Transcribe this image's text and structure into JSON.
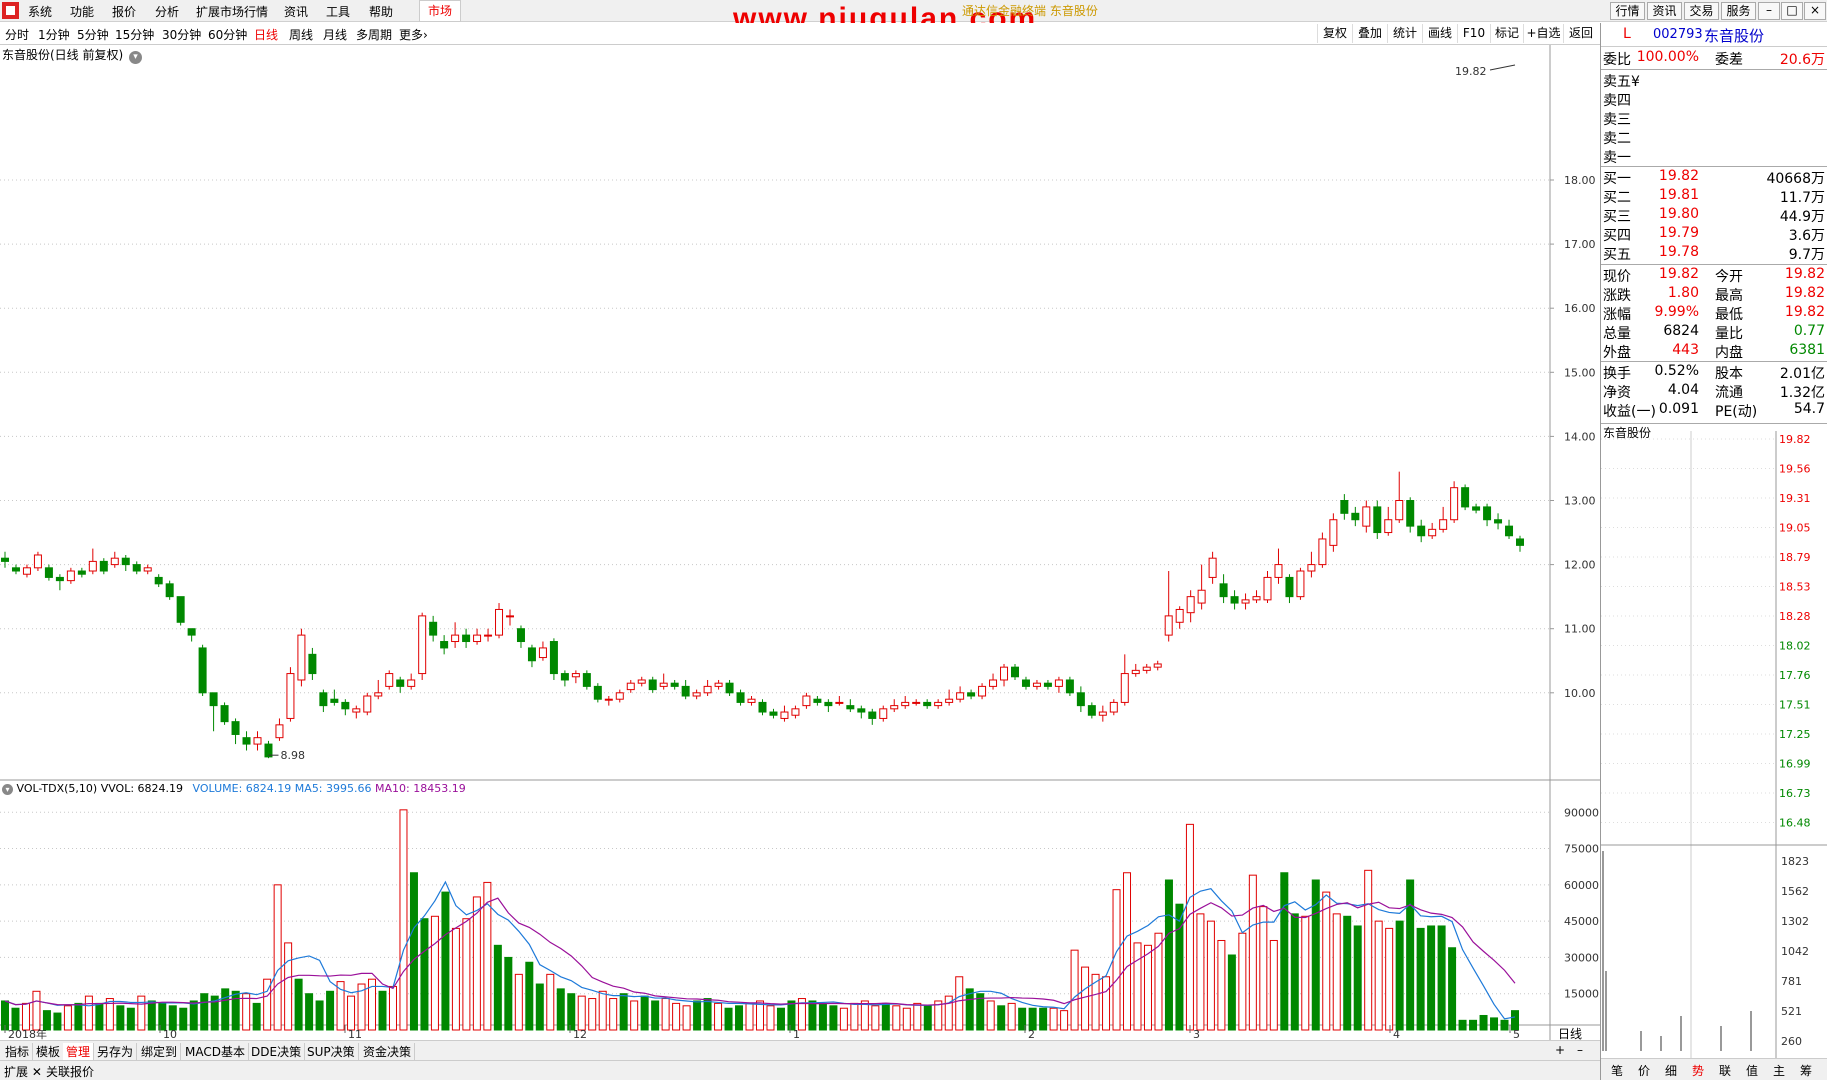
{
  "menu": {
    "items": [
      "系统",
      "功能",
      "报价",
      "分析",
      "扩展市场行情",
      "资讯",
      "工具",
      "帮助"
    ],
    "market_tab": "市场"
  },
  "watermark": "www.niugulan.com",
  "window_subtitle": "通达信金融终端 东音股份",
  "right_top_buttons": [
    "行情",
    "资讯",
    "交易",
    "服务"
  ],
  "period_bar": {
    "periods": [
      "分时",
      "1分钟",
      "5分钟",
      "15分钟",
      "30分钟",
      "60分钟",
      "日线",
      "周线",
      "月线",
      "多周期",
      "更多"
    ],
    "active": "日线",
    "tools": [
      "复权",
      "叠加",
      "统计",
      "画线",
      "F10",
      "标记",
      "+自选",
      "返回"
    ]
  },
  "chart_title": "东音股份(日线 前复权)",
  "right_axis": {
    "ticks": [
      "18.00",
      "17.00",
      "16.00",
      "15.00",
      "14.00",
      "13.00",
      "12.00",
      "11.00",
      "10.00"
    ],
    "vol_ticks": [
      "90000",
      "75000",
      "60000",
      "45000",
      "30000",
      "15000"
    ],
    "period_label": "日线"
  },
  "annotations": {
    "high": "19.82",
    "low": "8.98"
  },
  "volume_info": {
    "title": "VOL-TDX(5,10)",
    "vvol": "VVOL: 6824.19",
    "volume": "VOLUME: 6824.19",
    "ma5": "MA5: 3995.66",
    "ma10": "MA10: 18453.19"
  },
  "x_axis_labels": [
    "2018年",
    "10",
    "11",
    "12",
    "1",
    "2",
    "3",
    "4",
    "5"
  ],
  "bottom_tabs": [
    "指标",
    "模板",
    "管理",
    "另存为",
    "绑定到",
    "MACD基本",
    "DDE决策",
    "SUP决策",
    "资金决策"
  ],
  "bottom_tabs_active": "管理",
  "bottom_bar2": [
    "扩展",
    "关联报价"
  ],
  "quote": {
    "status": "L",
    "code": "002793",
    "name": "东音股份",
    "weibi_label": "委比",
    "weibi": "100.00%",
    "weicha_label": "委差",
    "weicha": "20.6万",
    "sells": [
      {
        "label": "卖五",
        "price": "",
        "vol": "",
        "mark": "¥"
      },
      {
        "label": "卖四",
        "price": "",
        "vol": ""
      },
      {
        "label": "卖三",
        "price": "",
        "vol": ""
      },
      {
        "label": "卖二",
        "price": "",
        "vol": ""
      },
      {
        "label": "卖一",
        "price": "",
        "vol": ""
      }
    ],
    "buys": [
      {
        "label": "买一",
        "price": "19.82",
        "vol": "40668万"
      },
      {
        "label": "买二",
        "price": "19.81",
        "vol": "11.7万"
      },
      {
        "label": "买三",
        "price": "19.80",
        "vol": "44.9万"
      },
      {
        "label": "买四",
        "price": "19.79",
        "vol": "3.6万"
      },
      {
        "label": "买五",
        "price": "19.78",
        "vol": "9.7万"
      }
    ],
    "stats": [
      {
        "l1": "现价",
        "v1": "19.82",
        "l2": "今开",
        "v2": "19.82",
        "c1": "red",
        "c2": "red"
      },
      {
        "l1": "涨跌",
        "v1": "1.80",
        "l2": "最高",
        "v2": "19.82",
        "c1": "red",
        "c2": "red"
      },
      {
        "l1": "涨幅",
        "v1": "9.99%",
        "l2": "最低",
        "v2": "19.82",
        "c1": "red",
        "c2": "red"
      },
      {
        "l1": "总量",
        "v1": "6824",
        "l2": "量比",
        "v2": "0.77",
        "c1": "",
        "c2": "green"
      },
      {
        "l1": "外盘",
        "v1": "443",
        "l2": "内盘",
        "v2": "6381",
        "c1": "red",
        "c2": "green"
      }
    ],
    "fin": [
      {
        "l1": "换手",
        "v1": "0.52%",
        "l2": "股本",
        "v2": "2.01亿"
      },
      {
        "l1": "净资",
        "v1": "4.04",
        "l2": "流通",
        "v2": "1.32亿"
      },
      {
        "l1": "收益(一)",
        "v1": "0.091",
        "l2": "PE(动)",
        "v2": "54.7"
      }
    ]
  },
  "mini_chart": {
    "name": "东音股份",
    "price_ticks": [
      "19.82",
      "19.56",
      "19.31",
      "19.05",
      "18.79",
      "18.53",
      "18.28",
      "18.02",
      "17.76",
      "17.51",
      "17.25",
      "16.99",
      "16.73",
      "16.48"
    ],
    "vol_ticks": [
      "1823",
      "1562",
      "1302",
      "1042",
      "781",
      "521",
      "260"
    ]
  },
  "right_tabs": [
    "笔",
    "价",
    "细",
    "势",
    "联",
    "值",
    "主",
    "筹"
  ],
  "right_tabs_active": "势",
  "colors": {
    "up": "#e00000",
    "down": "#008800",
    "ma5": "#1e7ad9",
    "ma10": "#9a109a"
  },
  "chart_data": {
    "type": "candlestick",
    "title": "东音股份(日线 前复权)",
    "ylim": [
      9.5,
      18.0
    ],
    "note_values": "approximate daily OHLC read off the chart",
    "candles": [
      [
        12.1,
        12.05,
        12.2,
        11.95
      ],
      [
        11.95,
        11.9,
        12.0,
        11.85
      ],
      [
        11.85,
        11.95,
        12.0,
        11.8
      ],
      [
        11.95,
        12.15,
        12.2,
        11.9
      ],
      [
        11.95,
        11.8,
        12.0,
        11.75
      ],
      [
        11.8,
        11.75,
        11.85,
        11.6
      ],
      [
        11.75,
        11.9,
        11.95,
        11.7
      ],
      [
        11.9,
        11.85,
        11.95,
        11.8
      ],
      [
        11.9,
        12.05,
        12.25,
        11.85
      ],
      [
        12.05,
        11.9,
        12.1,
        11.85
      ],
      [
        12.0,
        12.1,
        12.2,
        11.95
      ],
      [
        12.1,
        12.0,
        12.15,
        11.9
      ],
      [
        12.0,
        11.9,
        12.05,
        11.85
      ],
      [
        11.9,
        11.95,
        12.0,
        11.85
      ],
      [
        11.8,
        11.7,
        11.85,
        11.65
      ],
      [
        11.7,
        11.5,
        11.75,
        11.45
      ],
      [
        11.5,
        11.1,
        11.5,
        11.05
      ],
      [
        11.0,
        10.9,
        11.0,
        10.8
      ],
      [
        10.7,
        10.0,
        10.75,
        9.95
      ],
      [
        10.0,
        9.8,
        10.0,
        9.4
      ],
      [
        9.8,
        9.55,
        9.85,
        9.5
      ],
      [
        9.55,
        9.35,
        9.6,
        9.2
      ],
      [
        9.3,
        9.2,
        9.4,
        9.1
      ],
      [
        9.2,
        9.3,
        9.4,
        9.1
      ],
      [
        9.2,
        9.0,
        9.25,
        8.98
      ],
      [
        9.3,
        9.5,
        9.6,
        9.25
      ],
      [
        9.6,
        10.3,
        10.4,
        9.55
      ],
      [
        10.2,
        10.9,
        11.0,
        10.1
      ],
      [
        10.6,
        10.3,
        10.7,
        10.2
      ],
      [
        10.0,
        9.8,
        10.05,
        9.7
      ],
      [
        9.9,
        9.85,
        10.05,
        9.8
      ],
      [
        9.85,
        9.75,
        9.9,
        9.65
      ],
      [
        9.7,
        9.75,
        9.8,
        9.6
      ],
      [
        9.7,
        9.95,
        10.0,
        9.65
      ],
      [
        9.95,
        10.0,
        10.2,
        9.9
      ],
      [
        10.1,
        10.3,
        10.35,
        10.05
      ],
      [
        10.2,
        10.1,
        10.25,
        10.0
      ],
      [
        10.1,
        10.2,
        10.3,
        10.05
      ],
      [
        10.3,
        11.2,
        11.25,
        10.2
      ],
      [
        11.1,
        10.9,
        11.2,
        10.8
      ],
      [
        10.8,
        10.7,
        10.9,
        10.6
      ],
      [
        10.8,
        10.9,
        11.1,
        10.7
      ],
      [
        10.9,
        10.8,
        11.0,
        10.7
      ],
      [
        10.8,
        10.9,
        11.0,
        10.75
      ],
      [
        10.9,
        10.9,
        11.0,
        10.8
      ],
      [
        10.9,
        11.3,
        11.4,
        10.85
      ],
      [
        11.2,
        11.2,
        11.3,
        11.05
      ],
      [
        11.0,
        10.8,
        11.05,
        10.7
      ],
      [
        10.7,
        10.5,
        10.75,
        10.4
      ],
      [
        10.55,
        10.7,
        10.8,
        10.5
      ],
      [
        10.8,
        10.3,
        10.85,
        10.2
      ],
      [
        10.3,
        10.2,
        10.35,
        10.1
      ],
      [
        10.25,
        10.3,
        10.35,
        10.15
      ],
      [
        10.3,
        10.1,
        10.35,
        10.05
      ],
      [
        10.1,
        9.9,
        10.15,
        9.85
      ],
      [
        9.9,
        9.9,
        9.95,
        9.8
      ],
      [
        9.9,
        10.0,
        10.05,
        9.85
      ],
      [
        10.05,
        10.15,
        10.2,
        10.0
      ],
      [
        10.15,
        10.2,
        10.25,
        10.1
      ],
      [
        10.2,
        10.05,
        10.25,
        10.0
      ],
      [
        10.1,
        10.15,
        10.3,
        10.05
      ],
      [
        10.15,
        10.1,
        10.2,
        10.05
      ],
      [
        10.1,
        9.95,
        10.2,
        9.9
      ],
      [
        9.95,
        10.0,
        10.05,
        9.9
      ],
      [
        10.0,
        10.1,
        10.2,
        9.95
      ],
      [
        10.1,
        10.15,
        10.2,
        10.05
      ],
      [
        10.15,
        10.0,
        10.2,
        9.95
      ],
      [
        10.0,
        9.85,
        10.05,
        9.8
      ],
      [
        9.85,
        9.9,
        9.95,
        9.8
      ],
      [
        9.85,
        9.7,
        9.9,
        9.65
      ],
      [
        9.7,
        9.65,
        9.75,
        9.6
      ],
      [
        9.6,
        9.7,
        9.8,
        9.55
      ],
      [
        9.65,
        9.75,
        9.8,
        9.6
      ],
      [
        9.8,
        9.95,
        10.0,
        9.75
      ],
      [
        9.9,
        9.85,
        9.95,
        9.8
      ],
      [
        9.85,
        9.8,
        9.9,
        9.7
      ],
      [
        9.85,
        9.85,
        9.95,
        9.8
      ],
      [
        9.8,
        9.75,
        9.9,
        9.7
      ],
      [
        9.75,
        9.7,
        9.8,
        9.6
      ],
      [
        9.7,
        9.6,
        9.75,
        9.5
      ],
      [
        9.6,
        9.75,
        9.8,
        9.55
      ],
      [
        9.75,
        9.8,
        9.9,
        9.7
      ],
      [
        9.8,
        9.85,
        9.95,
        9.75
      ],
      [
        9.85,
        9.85,
        9.9,
        9.8
      ],
      [
        9.85,
        9.8,
        9.9,
        9.75
      ],
      [
        9.8,
        9.85,
        9.9,
        9.75
      ],
      [
        9.85,
        9.9,
        10.05,
        9.8
      ],
      [
        9.9,
        10.0,
        10.1,
        9.85
      ],
      [
        10.0,
        9.95,
        10.05,
        9.9
      ],
      [
        9.95,
        10.1,
        10.15,
        9.9
      ],
      [
        10.1,
        10.2,
        10.3,
        10.05
      ],
      [
        10.2,
        10.4,
        10.45,
        10.1
      ],
      [
        10.4,
        10.25,
        10.45,
        10.2
      ],
      [
        10.2,
        10.1,
        10.25,
        10.05
      ],
      [
        10.1,
        10.15,
        10.2,
        10.05
      ],
      [
        10.15,
        10.1,
        10.2,
        10.05
      ],
      [
        10.1,
        10.2,
        10.25,
        10.0
      ],
      [
        10.2,
        10.0,
        10.25,
        9.95
      ],
      [
        10.0,
        9.8,
        10.1,
        9.7
      ],
      [
        9.8,
        9.65,
        9.85,
        9.6
      ],
      [
        9.65,
        9.7,
        9.8,
        9.55
      ],
      [
        9.7,
        9.85,
        9.9,
        9.65
      ],
      [
        9.85,
        10.3,
        10.6,
        9.8
      ],
      [
        10.3,
        10.35,
        10.45,
        10.25
      ],
      [
        10.35,
        10.4,
        10.45,
        10.3
      ],
      [
        10.4,
        10.45,
        10.5,
        10.35
      ],
      [
        10.9,
        11.2,
        11.9,
        10.8
      ],
      [
        11.1,
        11.3,
        11.35,
        11.0
      ],
      [
        11.25,
        11.5,
        11.6,
        11.1
      ],
      [
        11.4,
        11.6,
        12.0,
        11.3
      ],
      [
        11.8,
        12.1,
        12.2,
        11.7
      ],
      [
        11.7,
        11.5,
        11.85,
        11.4
      ],
      [
        11.5,
        11.4,
        11.6,
        11.3
      ],
      [
        11.4,
        11.45,
        11.55,
        11.3
      ],
      [
        11.45,
        11.5,
        11.6,
        11.4
      ],
      [
        11.45,
        11.8,
        11.9,
        11.4
      ],
      [
        11.8,
        12.0,
        12.25,
        11.7
      ],
      [
        11.8,
        11.5,
        11.85,
        11.4
      ],
      [
        11.5,
        11.9,
        11.95,
        11.45
      ],
      [
        11.9,
        12.0,
        12.2,
        11.8
      ],
      [
        12.0,
        12.4,
        12.5,
        11.95
      ],
      [
        12.3,
        12.7,
        12.8,
        12.2
      ],
      [
        13.0,
        12.8,
        13.1,
        12.7
      ],
      [
        12.8,
        12.7,
        12.9,
        12.6
      ],
      [
        12.6,
        12.9,
        13.0,
        12.5
      ],
      [
        12.9,
        12.5,
        13.0,
        12.4
      ],
      [
        12.5,
        12.7,
        12.9,
        12.45
      ],
      [
        12.7,
        13.0,
        13.45,
        12.65
      ],
      [
        13.0,
        12.6,
        13.05,
        12.5
      ],
      [
        12.6,
        12.45,
        12.7,
        12.35
      ],
      [
        12.45,
        12.55,
        12.65,
        12.4
      ],
      [
        12.55,
        12.7,
        12.9,
        12.5
      ],
      [
        12.7,
        13.2,
        13.3,
        12.65
      ],
      [
        13.2,
        12.9,
        13.25,
        12.85
      ],
      [
        12.9,
        12.85,
        12.95,
        12.8
      ],
      [
        12.9,
        12.7,
        12.95,
        12.6
      ],
      [
        12.7,
        12.65,
        12.8,
        12.55
      ],
      [
        12.6,
        12.45,
        12.7,
        12.4
      ],
      [
        12.4,
        12.3,
        12.45,
        12.2
      ]
    ],
    "volume": [
      12000,
      9000,
      11000,
      16000,
      8000,
      7000,
      10000,
      11000,
      14000,
      11000,
      13000,
      10000,
      9000,
      14000,
      12000,
      11000,
      10000,
      9000,
      12000,
      15000,
      14000,
      17000,
      16000,
      15000,
      11000,
      21000,
      60000,
      36000,
      21000,
      15000,
      12000,
      16000,
      20000,
      14000,
      19000,
      21000,
      16000,
      18000,
      91000,
      65000,
      46000,
      47000,
      57000,
      42000,
      46000,
      55000,
      61000,
      35000,
      30000,
      23000,
      28000,
      19000,
      23000,
      17000,
      15000,
      14000,
      13000,
      16000,
      13000,
      15000,
      12000,
      14000,
      12000,
      13000,
      11000,
      10000,
      12000,
      13000,
      11000,
      9000,
      10000,
      11000,
      12000,
      10000,
      9000,
      12000,
      13000,
      12000,
      11000,
      10000,
      9000,
      11000,
      12000,
      10000,
      11000,
      10000,
      9000,
      11000,
      10000,
      12000,
      14000,
      22000,
      17000,
      15000,
      12000,
      10000,
      11000,
      9000,
      9000,
      9000,
      9000,
      8000,
      33000,
      26000,
      23000,
      22000,
      58000,
      65000,
      36000,
      35000,
      40000,
      62000,
      52000,
      85000,
      48000,
      45000,
      37000,
      31000,
      40000,
      64000,
      51000,
      37000,
      65000,
      48000,
      47000,
      62000,
      57000,
      48000,
      47000,
      43000,
      66000,
      45000,
      42000,
      45000,
      62000,
      42000,
      43000,
      43000,
      34000,
      4000,
      4000,
      6000,
      5000,
      4000,
      8000
    ]
  }
}
